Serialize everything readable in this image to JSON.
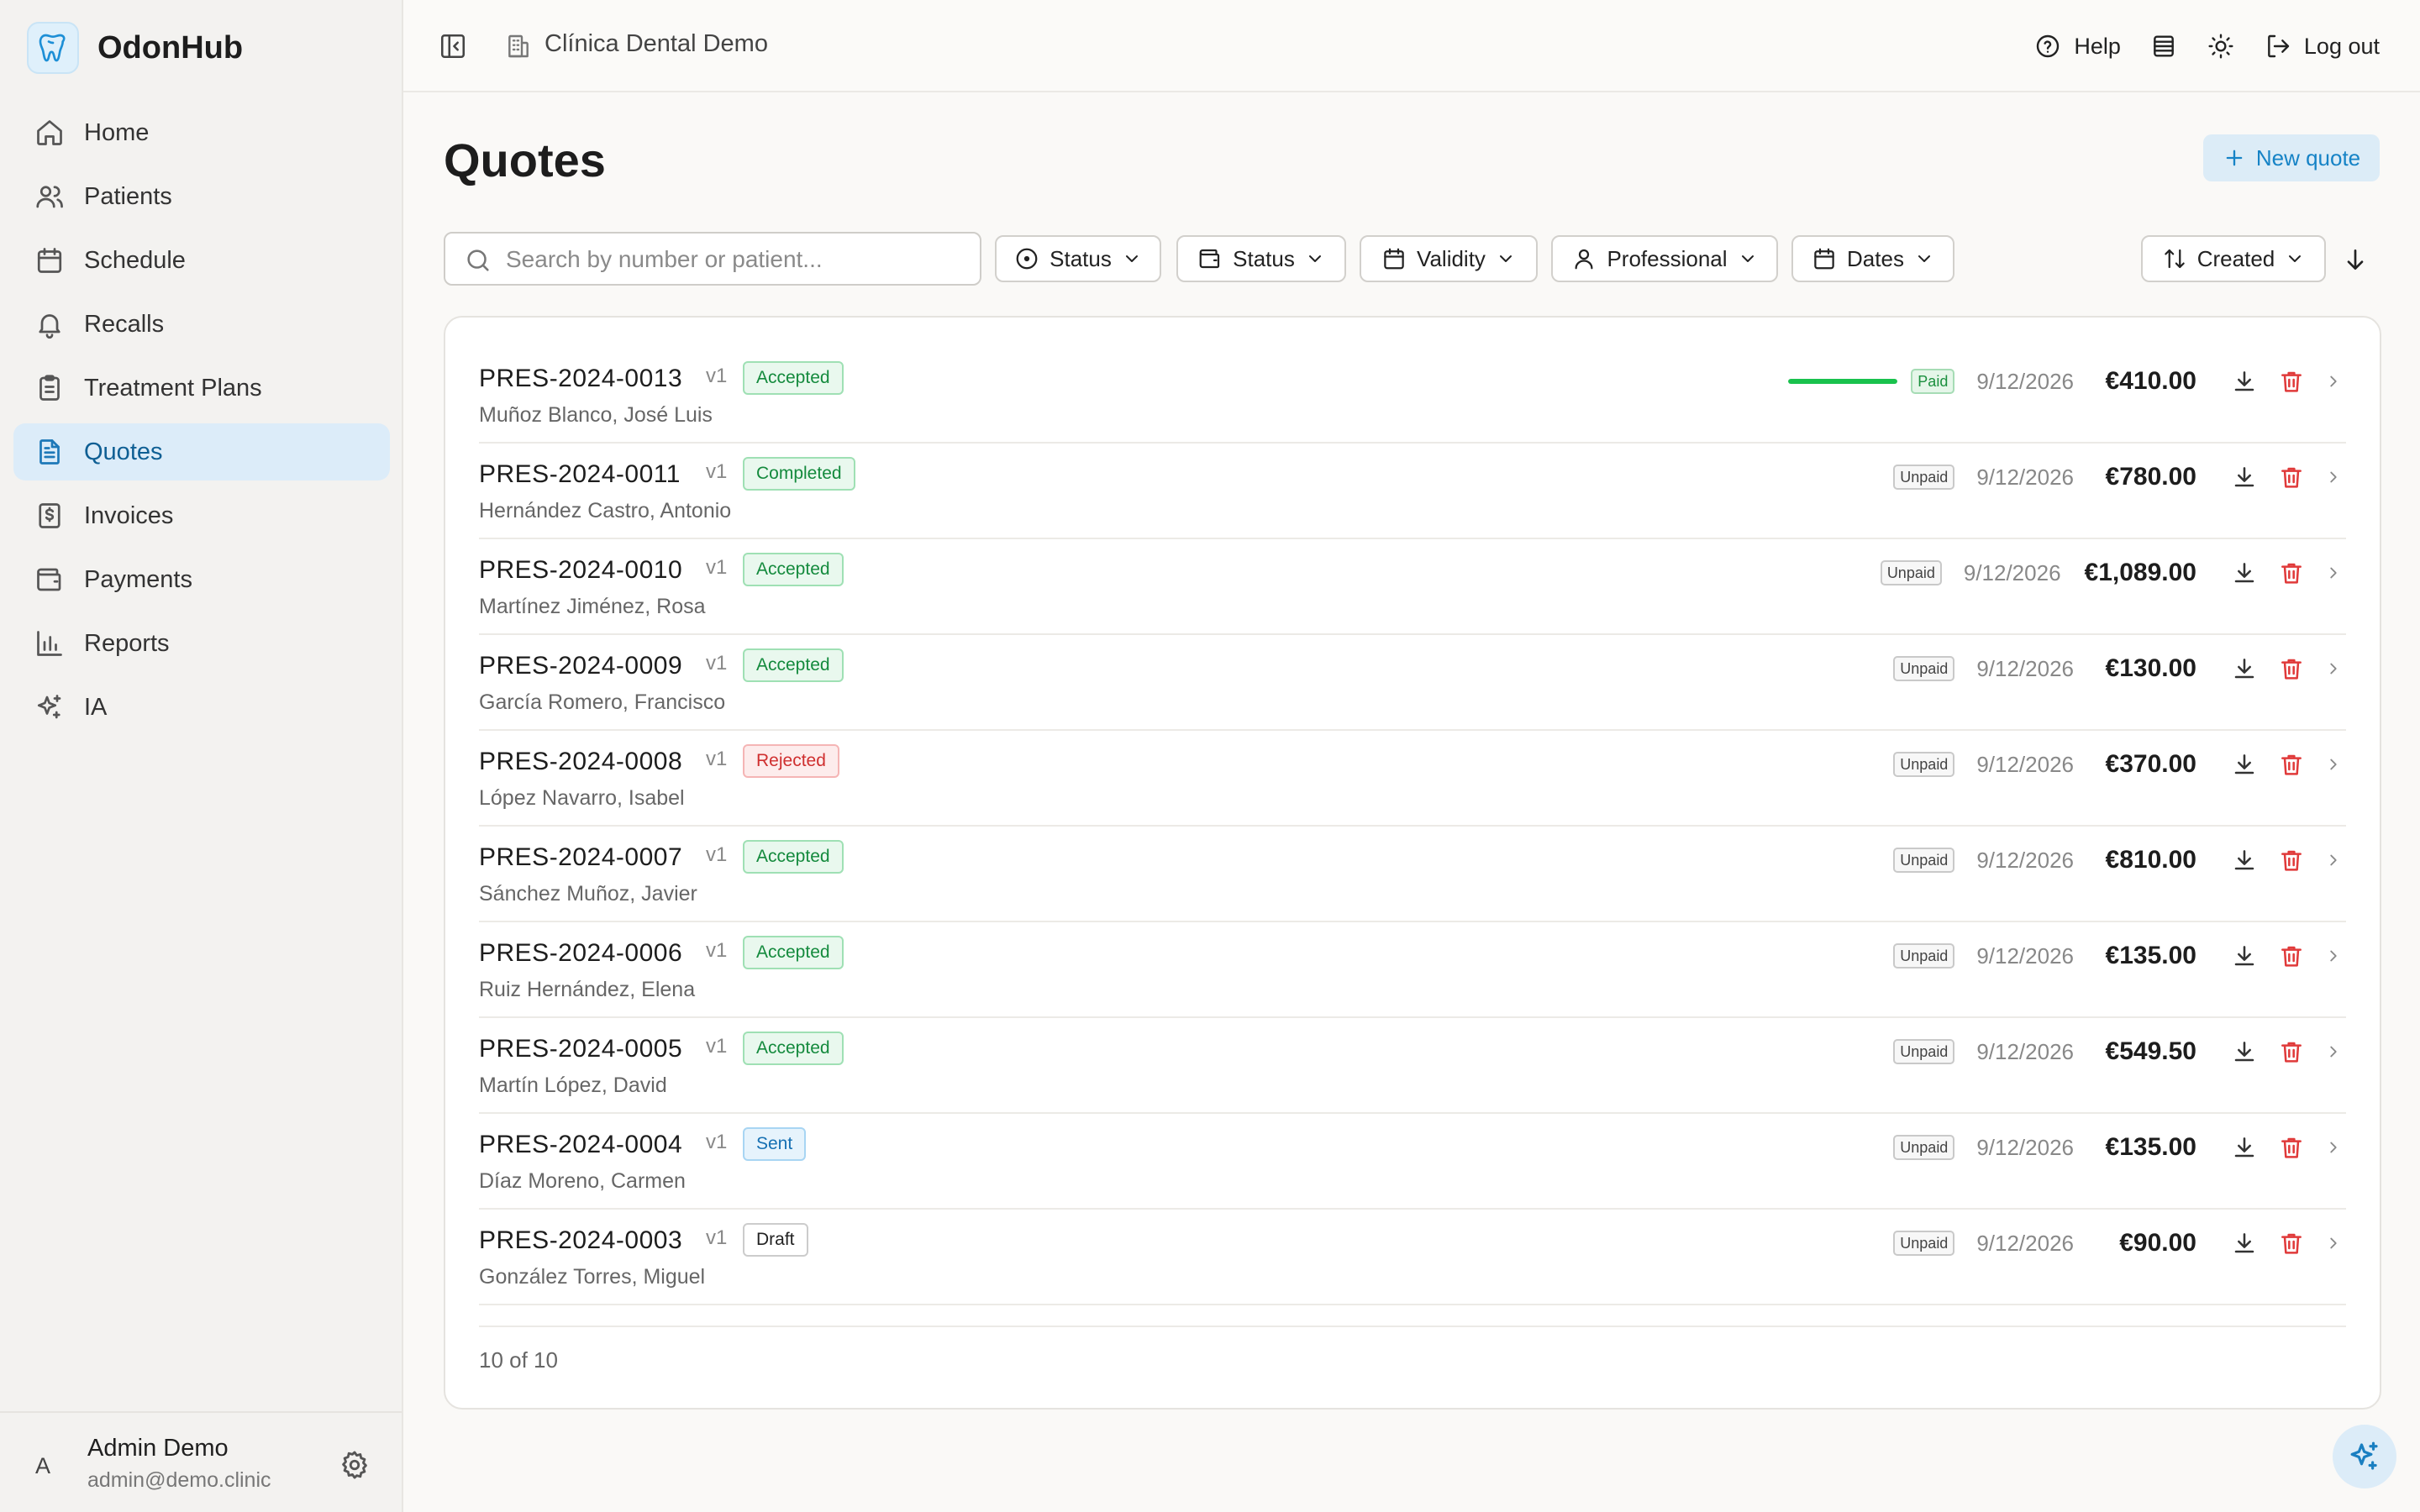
{
  "brand": {
    "name": "OdonHub"
  },
  "sidebar": {
    "items": [
      {
        "label": "Home",
        "icon": "home-icon"
      },
      {
        "label": "Patients",
        "icon": "users-icon"
      },
      {
        "label": "Schedule",
        "icon": "calendar-icon"
      },
      {
        "label": "Recalls",
        "icon": "bell-icon"
      },
      {
        "label": "Treatment Plans",
        "icon": "clipboard-icon"
      },
      {
        "label": "Quotes",
        "icon": "file-text-icon",
        "active": true
      },
      {
        "label": "Invoices",
        "icon": "receipt-icon"
      },
      {
        "label": "Payments",
        "icon": "wallet-icon"
      },
      {
        "label": "Reports",
        "icon": "bar-chart-icon"
      },
      {
        "label": "IA",
        "icon": "sparkles-icon"
      }
    ],
    "user": {
      "initial": "A",
      "name": "Admin Demo",
      "email": "admin@demo.clinic"
    }
  },
  "topbar": {
    "clinic": "Clínica Dental Demo",
    "help": "Help",
    "logout": "Log out"
  },
  "page": {
    "title": "Quotes",
    "new_quote": "New quote"
  },
  "filters": {
    "search_placeholder": "Search by number or patient...",
    "status1": "Status",
    "status2": "Status",
    "validity": "Validity",
    "professional": "Professional",
    "dates": "Dates",
    "sort": "Created"
  },
  "quotes": [
    {
      "number": "PRES-2024-0013",
      "version": "v1",
      "status": "Accepted",
      "status_kind": "accepted",
      "patient": "Muñoz Blanco, José Luis",
      "payment": "Paid",
      "paid_fraction": 1.0,
      "date": "9/12/2026",
      "amount": "€410.00"
    },
    {
      "number": "PRES-2024-0011",
      "version": "v1",
      "status": "Completed",
      "status_kind": "completed",
      "patient": "Hernández Castro, Antonio",
      "payment": "Unpaid",
      "date": "9/12/2026",
      "amount": "€780.00"
    },
    {
      "number": "PRES-2024-0010",
      "version": "v1",
      "status": "Accepted",
      "status_kind": "accepted",
      "patient": "Martínez Jiménez, Rosa",
      "payment": "Unpaid",
      "date": "9/12/2026",
      "amount": "€1,089.00"
    },
    {
      "number": "PRES-2024-0009",
      "version": "v1",
      "status": "Accepted",
      "status_kind": "accepted",
      "patient": "García Romero, Francisco",
      "payment": "Unpaid",
      "date": "9/12/2026",
      "amount": "€130.00"
    },
    {
      "number": "PRES-2024-0008",
      "version": "v1",
      "status": "Rejected",
      "status_kind": "rejected",
      "patient": "López Navarro, Isabel",
      "payment": "Unpaid",
      "date": "9/12/2026",
      "amount": "€370.00"
    },
    {
      "number": "PRES-2024-0007",
      "version": "v1",
      "status": "Accepted",
      "status_kind": "accepted",
      "patient": "Sánchez Muñoz, Javier",
      "payment": "Unpaid",
      "date": "9/12/2026",
      "amount": "€810.00"
    },
    {
      "number": "PRES-2024-0006",
      "version": "v1",
      "status": "Accepted",
      "status_kind": "accepted",
      "patient": "Ruiz Hernández, Elena",
      "payment": "Unpaid",
      "date": "9/12/2026",
      "amount": "€135.00"
    },
    {
      "number": "PRES-2024-0005",
      "version": "v1",
      "status": "Accepted",
      "status_kind": "accepted",
      "patient": "Martín López, David",
      "payment": "Unpaid",
      "date": "9/12/2026",
      "amount": "€549.50"
    },
    {
      "number": "PRES-2024-0004",
      "version": "v1",
      "status": "Sent",
      "status_kind": "sent",
      "patient": "Díaz Moreno, Carmen",
      "payment": "Unpaid",
      "date": "9/12/2026",
      "amount": "€135.00"
    },
    {
      "number": "PRES-2024-0003",
      "version": "v1",
      "status": "Draft",
      "status_kind": "draft",
      "patient": "González Torres, Miguel",
      "payment": "Unpaid",
      "date": "9/12/2026",
      "amount": "€90.00"
    }
  ],
  "pagination": {
    "count": "10 of 10"
  },
  "colors": {
    "accent": "#1683c6",
    "active_nav_bg": "#dcecf9",
    "paid_bar": "#19c24d",
    "delete": "#e03a3a"
  }
}
